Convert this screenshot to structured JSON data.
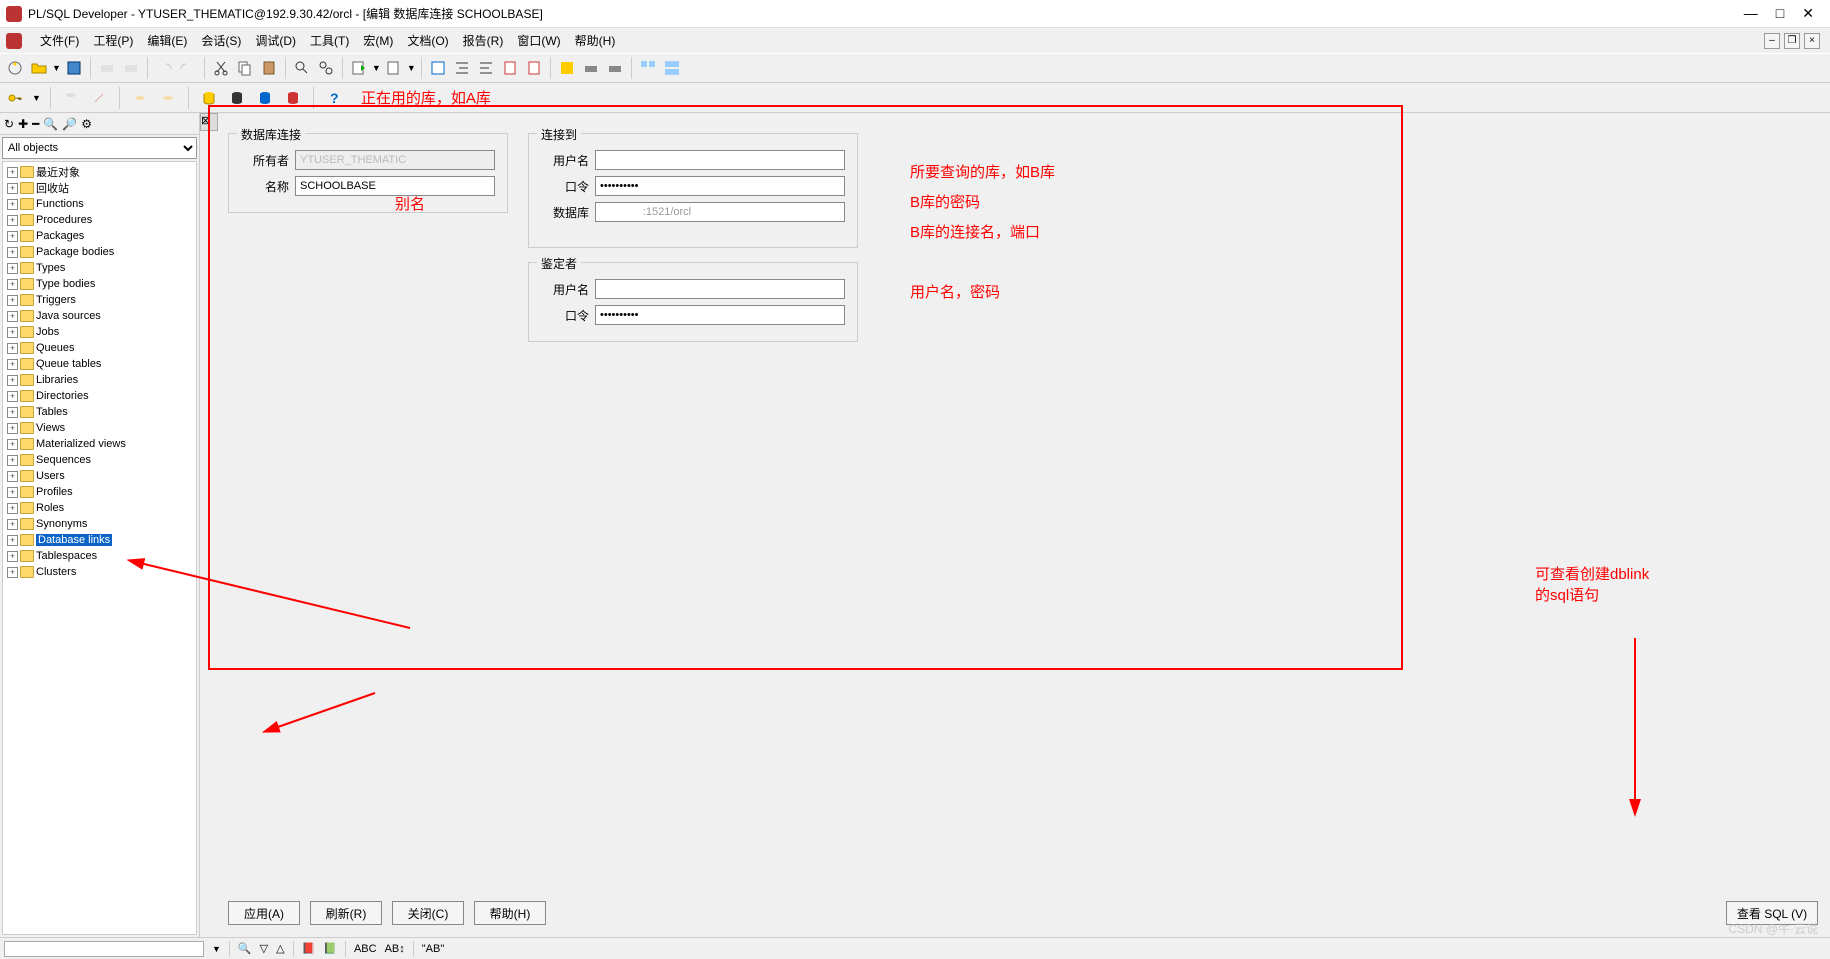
{
  "title": "PL/SQL Developer - YTUSER_THEMATIC@192.9.30.42/orcl - [编辑 数据库连接 SCHOOLBASE]",
  "menu": {
    "file": "文件(F)",
    "project": "工程(P)",
    "edit": "编辑(E)",
    "session": "会话(S)",
    "debug": "调试(D)",
    "tools": "工具(T)",
    "macro": "宏(M)",
    "docs": "文档(O)",
    "report": "报告(R)",
    "window": "窗口(W)",
    "help": "帮助(H)"
  },
  "anno": {
    "top": "正在用的库，如A库",
    "alias": "别名",
    "user": "所要查询的库，如B库",
    "pwd": "B库的密码",
    "db": "B库的连接名，端口",
    "auth": "用户名，密码",
    "right": "可查看创建dblink的sql语句"
  },
  "side": {
    "selector": "All objects",
    "items": [
      "最近对象",
      "回收站",
      "Functions",
      "Procedures",
      "Packages",
      "Package bodies",
      "Types",
      "Type bodies",
      "Triggers",
      "Java sources",
      "Jobs",
      "Queues",
      "Queue tables",
      "Libraries",
      "Directories",
      "Tables",
      "Views",
      "Materialized views",
      "Sequences",
      "Users",
      "Profiles",
      "Roles",
      "Synonyms",
      "Database links",
      "Tablespaces",
      "Clusters"
    ],
    "selected": "Database links"
  },
  "form": {
    "g1_title": "数据库连接",
    "owner_lbl": "所有者",
    "owner_val": "YTUSER_THEMATIC",
    "name_lbl": "名称",
    "name_val": "SCHOOLBASE",
    "g2_title": "连接到",
    "user_lbl": "用户名",
    "user_val": "",
    "pwd_lbl": "口令",
    "pwd_val": "**********",
    "db_lbl": "数据库",
    "db_val": "              :1521/orcl",
    "g3_title": "鉴定者",
    "auth_user_lbl": "用户名",
    "auth_user_val": "",
    "auth_pwd_lbl": "口令",
    "auth_pwd_val": "**********"
  },
  "buttons": {
    "apply": "应用(A)",
    "refresh": "刷新(R)",
    "close": "关闭(C)",
    "help": "帮助(H)",
    "viewsql": "查看 SQL (V)"
  },
  "status": {
    "ab": "\"AB\""
  },
  "watermark": "CSDN @牛·云说"
}
